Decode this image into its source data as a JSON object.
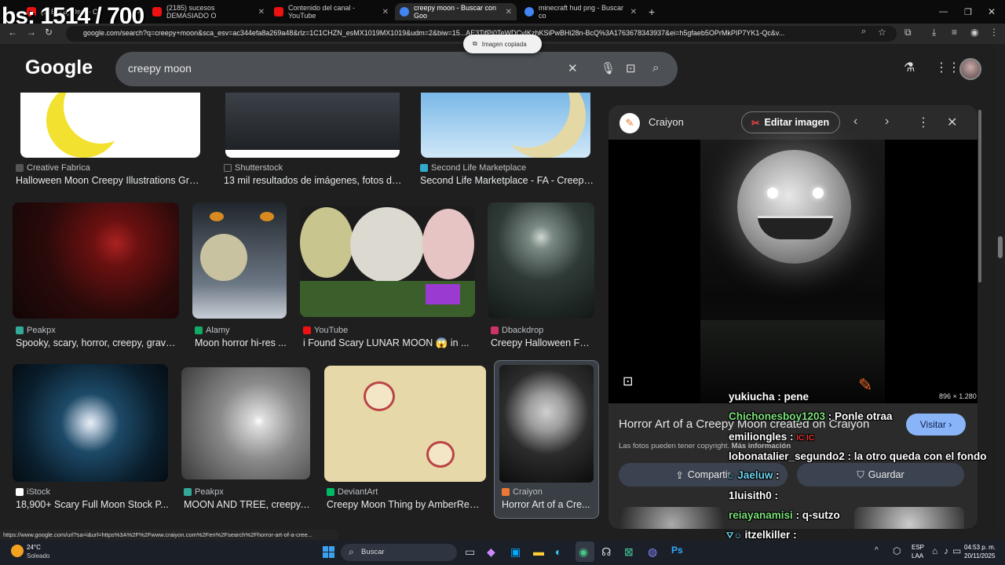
{
  "overlay_counter": "bs: 1514 / 700",
  "tabs": [
    {
      "label": "(2180) 8) Osm - Cr",
      "color": "#e11"
    },
    {
      "label": "(2185) sucesos DEMASIADO O",
      "color": "#e11"
    },
    {
      "label": "Contenido del canal - YouTube",
      "color": "#e11"
    },
    {
      "label": "creepy moon - Buscar con Goo",
      "color": "#4285f4"
    },
    {
      "label": "minecraft hud png - Buscar co",
      "color": "#4285f4"
    }
  ],
  "address": "google.com/search?q=creepy+moon&sca_esv=ac344efa8a269a48&rlz=1C1CHZN_esMX1019MX1019&udm=2&biw=15...AE3TifPi0TeWDCyIKzhKSiPwBHi28n-BcQ%3A1763678343937&ei=h5gfaeb5OPrMkPIP7YK1-Qc&v...",
  "toast": "Imagen copiada",
  "logo": "Google",
  "search": {
    "query": "creepy moon"
  },
  "results": [
    {
      "source": "Creative Fabrica",
      "title": "Halloween Moon Creepy Illustrations Gráfi...",
      "fav": "#555"
    },
    {
      "source": "Shutterstock",
      "title": "13 mil resultados de imágenes, fotos de...",
      "fav": "#222"
    },
    {
      "source": "Second Life Marketplace",
      "title": "Second Life Marketplace - FA - Creepy...",
      "fav": "#3ac"
    },
    {
      "source": "Peakpx",
      "title": "Spooky, scary, horror, creepy, grave...",
      "fav": "#3a9"
    },
    {
      "source": "Alamy",
      "title": "Moon horror hi-res ...",
      "fav": "#1a6"
    },
    {
      "source": "YouTube",
      "title": "i Found Scary LUNAR MOON 😱 in ...",
      "fav": "#e11"
    },
    {
      "source": "Dbackdrop",
      "title": "Creepy Halloween Fo...",
      "fav": "#c36"
    },
    {
      "source": "iStock",
      "title": "18,900+ Scary Full Moon Stock P...",
      "fav": "#fff"
    },
    {
      "source": "Peakpx",
      "title": "MOON AND TREE, creepy,...",
      "fav": "#3a9"
    },
    {
      "source": "DeviantArt",
      "title": "Creepy Moon Thing by AmberReve...",
      "fav": "#0b6"
    },
    {
      "source": "Craiyon",
      "title": "Horror Art of a Cre...",
      "fav": "#e73"
    }
  ],
  "panel": {
    "site": "Craiyon",
    "edit_label": "Editar imagen",
    "dimensions": "896 × 1.280",
    "title": "Horror Art of a Creepy Moon created on Craiyon",
    "visit_label": "Visitar",
    "copyright": "Las fotos pueden tener copyright.",
    "more_info": "Más información",
    "share_label": "Compartir",
    "save_label": "Guardar"
  },
  "chat": [
    {
      "user": "yukiucha",
      "msg": " : pene",
      "color": "#ffffff"
    },
    {
      "user": "Chichonesboy1203",
      "msg": " : Ponle otraa",
      "color": "#9f9"
    },
    {
      "user": "emiliongles",
      "msg": " : ",
      "color": "#fff"
    },
    {
      "user": "lobonatalier_segundo2",
      "msg": " : la otro queda con el fondo",
      "color": "#fff"
    },
    {
      "user": "Jaeluw",
      "msg": " : ",
      "color": "#7df"
    },
    {
      "user": "1luisith0",
      "msg": " : ",
      "color": "#fff"
    },
    {
      "user": "reiayanamisi",
      "msg": " : q-sutzo",
      "color": "#9f9"
    },
    {
      "user": "itzelkiller",
      "msg": " : ",
      "color": "#fff"
    },
    {
      "user": "lobonatalier_segundo2",
      "msg": " : ",
      "color": "#fff"
    }
  ],
  "status_url": "https://www.google.com/url?sa=i&url=https%3A%2F%2Fwww.craiyon.com%2Fen%2Fsearch%2Fhorror-art-of-a-cree...",
  "taskbar": {
    "temp": "24°C",
    "weather": "Soleado",
    "search_label": "Buscar",
    "lang1": "ESP",
    "lang2": "LAA",
    "time": "04:53 p. m.",
    "date": "20/11/2025"
  }
}
